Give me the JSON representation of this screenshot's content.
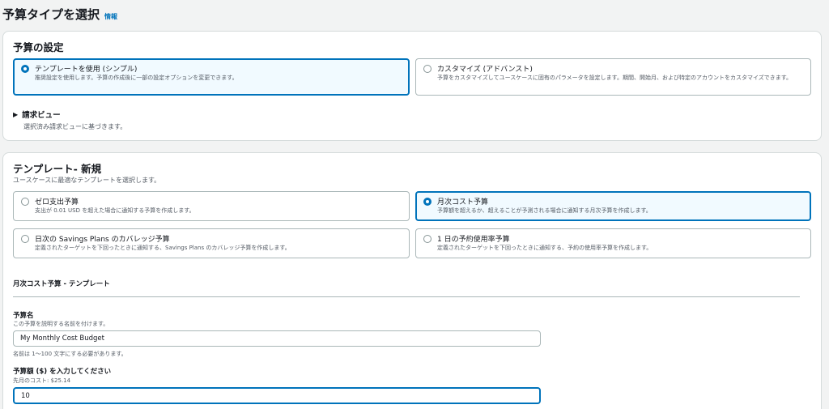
{
  "header": {
    "title": "予算タイプを選択",
    "info": "情報"
  },
  "settings": {
    "title": "予算の設定",
    "options": [
      {
        "label": "テンプレートを使用 (シンプル)",
        "description": "推奨設定を使用します。予算の作成後に一部の設定オプションを変更できます。",
        "selected": true
      },
      {
        "label": "カスタマイズ (アドバンスト)",
        "description": "予算をカスタマイズしてユースケースに固有のパラメータを設定します。期間、開始月、および特定のアカウントをカスタマイズできます。",
        "selected": false
      }
    ],
    "expander": {
      "label": "請求ビュー",
      "description": "選択済み請求ビューに基づきます。"
    }
  },
  "templates": {
    "title": "テンプレート- 新規",
    "description": "ユースケースに最適なテンプレートを選択します。",
    "options": [
      {
        "label": "ゼロ支出予算",
        "description": "支出が 0.01 USD を超えた場合に通知する予算を作成します。",
        "selected": false
      },
      {
        "label": "月次コスト予算",
        "description": "予算額を超えるか、超えることが予測される場合に通知する月次予算を作成します。",
        "selected": true
      },
      {
        "label": "日次の Savings Plans のカバレッジ予算",
        "description": "定義されたターゲットを下回ったときに通知する、Savings Plans のカバレッジ予算を作成します。",
        "selected": false
      },
      {
        "label": "1 日の予約使用率予算",
        "description": "定義されたターゲットを下回ったときに通知する、予約の使用率予算を作成します。",
        "selected": false
      }
    ],
    "subheading": "月次コスト予算 - テンプレート",
    "budget_name": {
      "label": "予算名",
      "description": "この予算を説明する名前を付けます。",
      "value": "My Monthly Cost Budget",
      "constraint": "名前は 1〜100 文字にする必要があります。"
    },
    "budget_amount": {
      "label": "予算額 ($) を入力してください",
      "description": "先月のコスト: $25.14",
      "value": "10"
    }
  },
  "colors": {
    "accent": "#0073bb",
    "selected_bg": "#f1faff",
    "border": "#aab7b8",
    "page_bg": "#f2f3f3"
  }
}
